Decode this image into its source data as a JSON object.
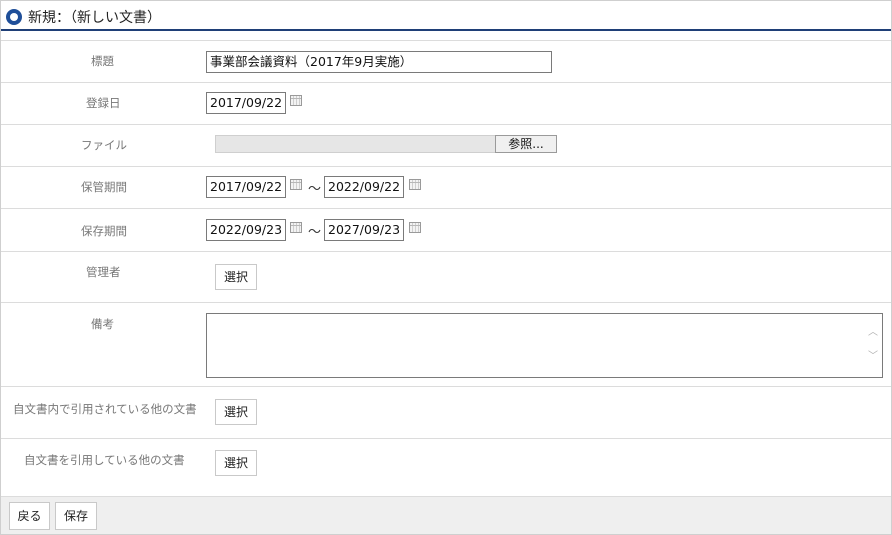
{
  "header": {
    "title": "新規：（新しい文書）"
  },
  "form": {
    "title_label": "標題",
    "title_value": "事業部会議資料（2017年9月実施）",
    "registered_label": "登録日",
    "registered_value": "2017/09/22",
    "file_label": "ファイル",
    "browse_label": "参照...",
    "storage_label": "保管期間",
    "storage_from": "2017/09/22",
    "storage_to": "2022/09/22",
    "retention_label": "保存期間",
    "retention_from": "2022/09/23",
    "retention_to": "2027/09/23",
    "separator": "～",
    "manager_label": "管理者",
    "select_label": "選択",
    "remarks_label": "備考",
    "cited_by_self_label": "自文書内で引用されている他の文書",
    "citing_self_label": "自文書を引用している他の文書"
  },
  "footer": {
    "back_label": "戻る",
    "save_label": "保存"
  },
  "icons": {
    "title": "circle-marker-icon",
    "calendar": "calendar-icon"
  },
  "colors": {
    "accent": "#1f3f77",
    "marker": "#1f4f99"
  }
}
